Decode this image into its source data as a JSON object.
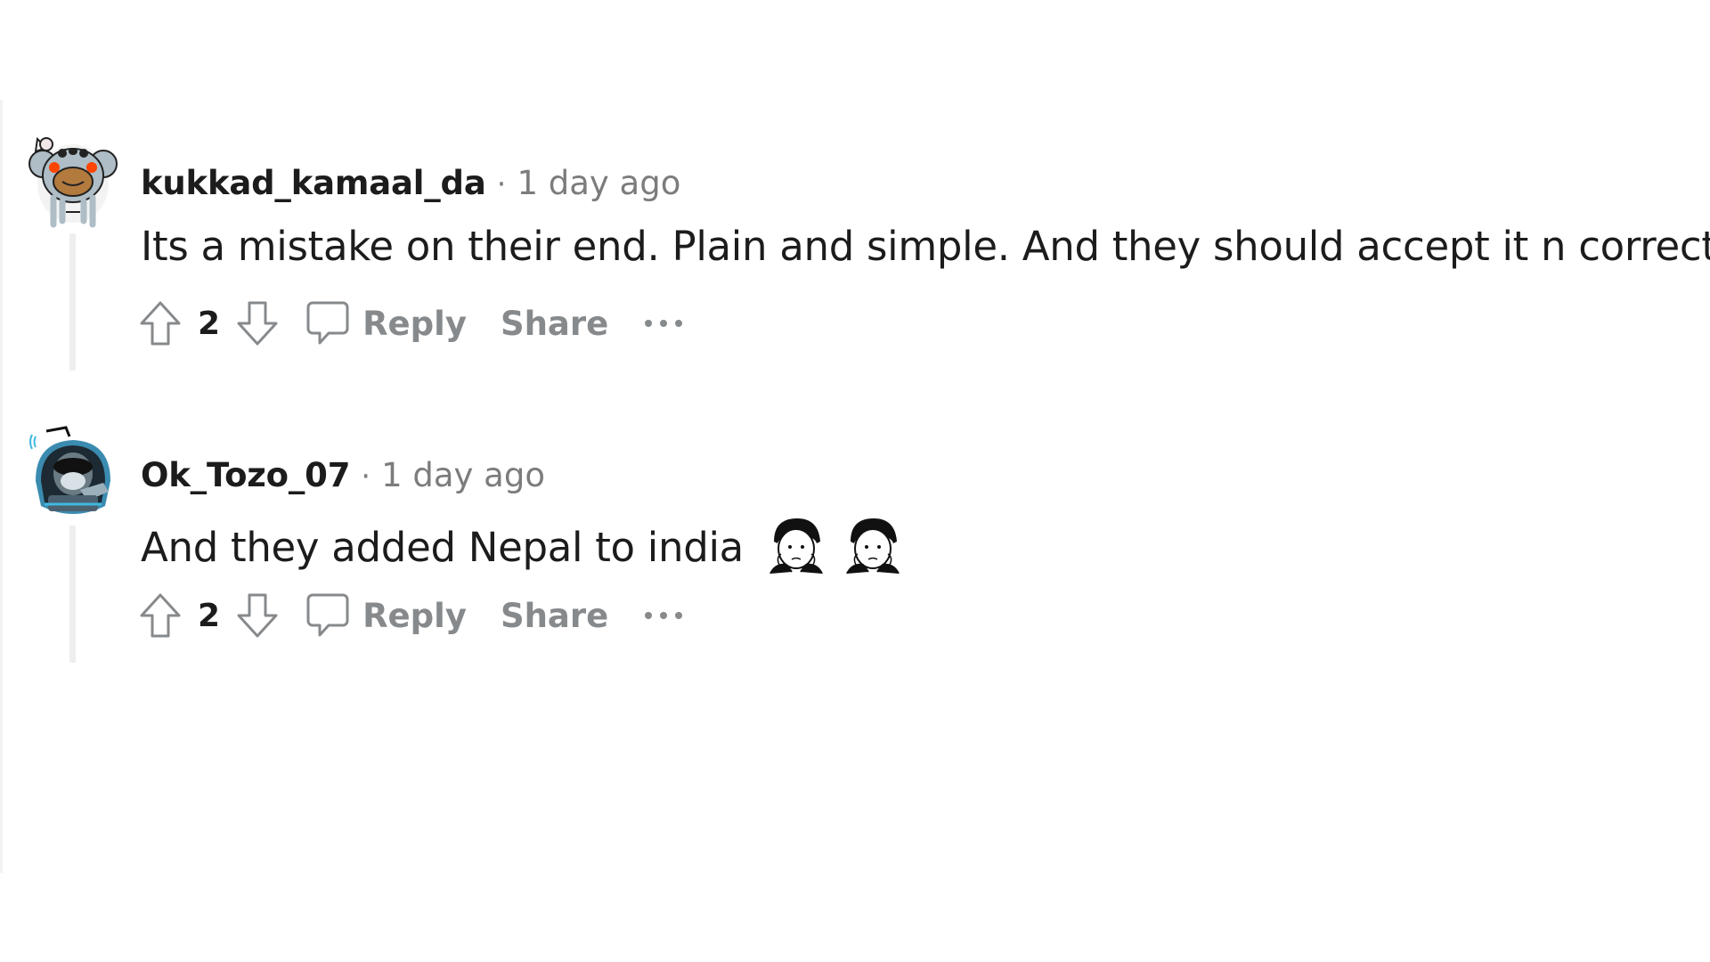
{
  "comments": [
    {
      "username": "kukkad_kamaal_da",
      "separator": "·",
      "time": "1 day ago",
      "text": "Its a mistake on their end. Plain and simple. And they should accept it n correct it",
      "score": "2",
      "reply_label": "Reply",
      "share_label": "Share",
      "avatar_icon": "koala-avatar-icon",
      "emojis": []
    },
    {
      "username": "Ok_Tozo_07",
      "separator": "·",
      "time": "1 day ago",
      "text": "And they added Nepal to india",
      "score": "2",
      "reply_label": "Reply",
      "share_label": "Share",
      "avatar_icon": "hooded-figure-avatar-icon",
      "emojis": [
        "wojak-face-emoji",
        "wojak-face-emoji"
      ]
    }
  ],
  "colors": {
    "text": "#1c1c1c",
    "meta": "#7c7c7c",
    "action": "#878a8c",
    "thread_line": "#eceef0"
  }
}
